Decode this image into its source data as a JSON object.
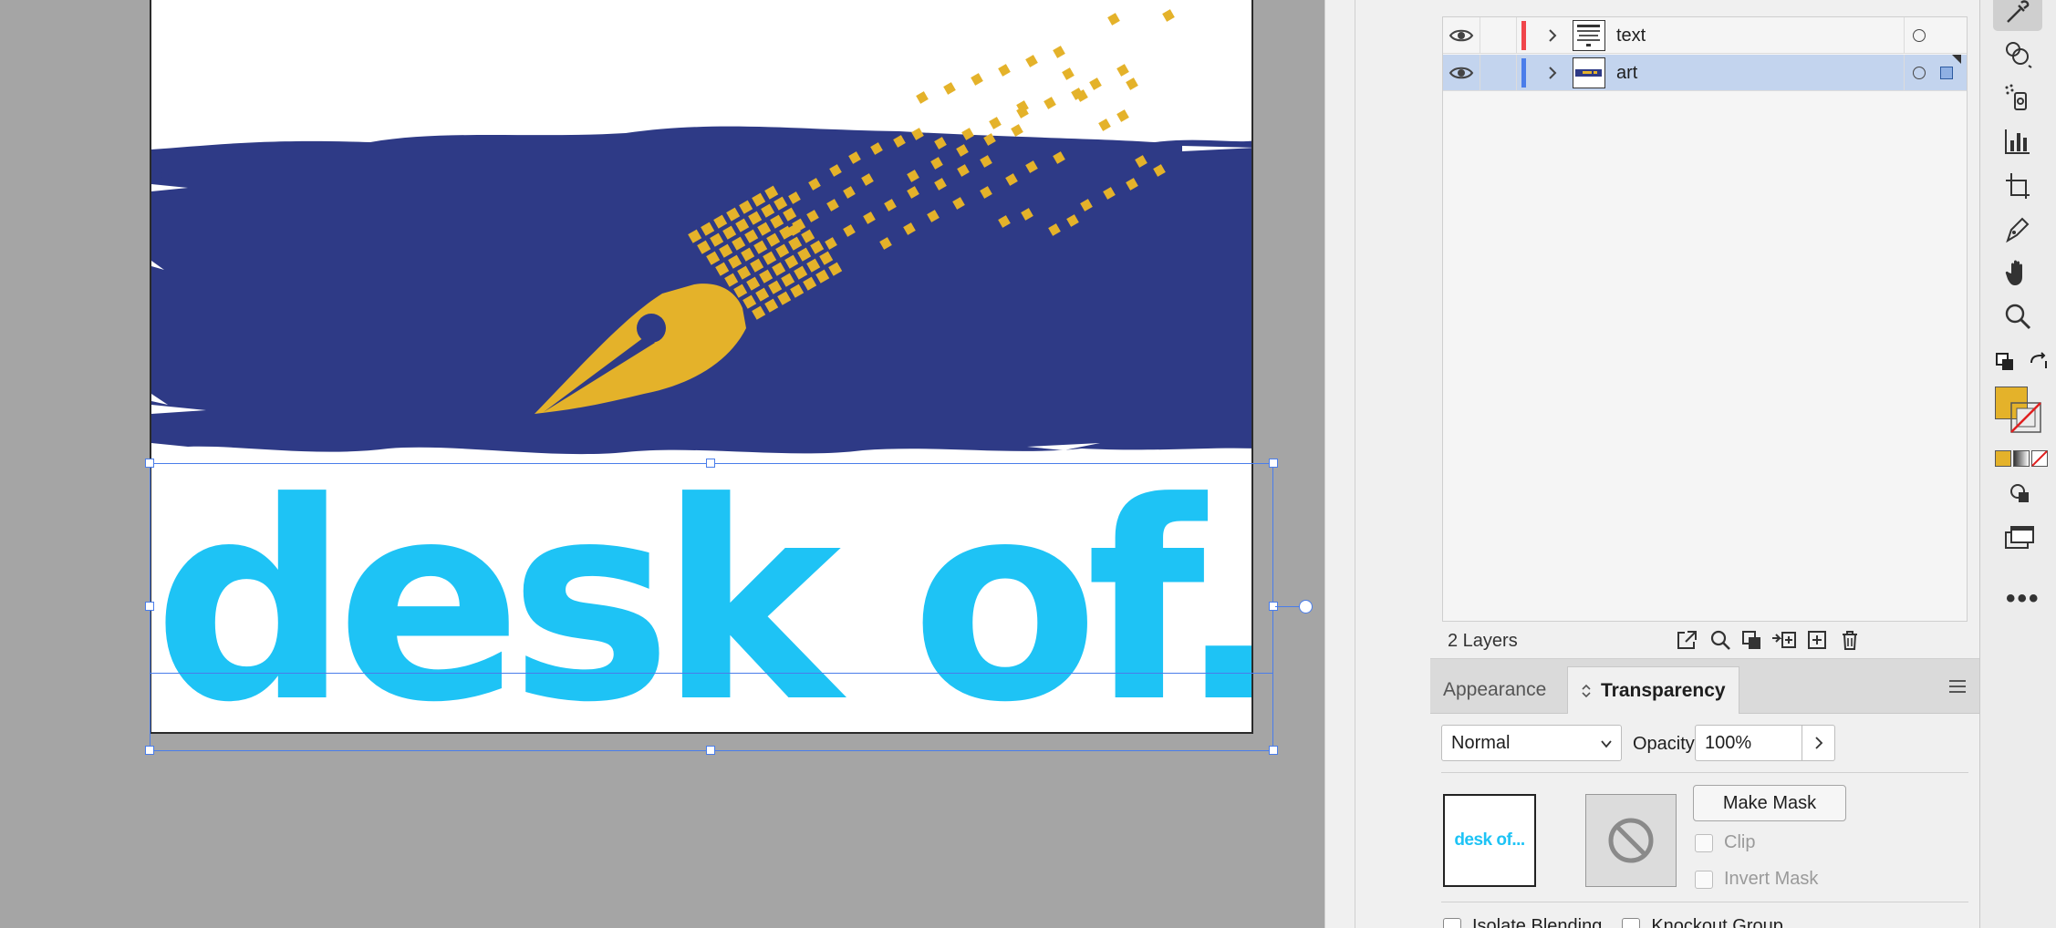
{
  "artboard": {
    "headline_text": "desk of...",
    "colors": {
      "blue_band": "#2e3a86",
      "gold": "#e4b22a",
      "cyan": "#1ec3f5"
    }
  },
  "layers_panel": {
    "layers": [
      {
        "name": "text",
        "color": "#f0454b",
        "selected": false
      },
      {
        "name": "art",
        "color": "#4a7dea",
        "selected": true
      }
    ],
    "layer_count": "2 Layers"
  },
  "transparency_panel": {
    "tabs": [
      {
        "label": "Appearance",
        "active": false
      },
      {
        "label": "Transparency",
        "active": true
      }
    ],
    "blend_mode": "Normal",
    "opacity_label": "Opacity:",
    "opacity_value": "100%",
    "object_thumb_text": "desk of...",
    "make_mask_label": "Make Mask",
    "clip_label": "Clip",
    "invert_mask_label": "Invert Mask",
    "isolate_blending_label": "Isolate Blending",
    "knockout_group_label": "Knockout Group"
  },
  "toolbar": {
    "tools": [
      "eyedropper-icon",
      "shape-builder-icon",
      "symbol-sprayer-icon",
      "graph-icon",
      "artboard-icon",
      "pen-icon",
      "hand-icon",
      "zoom-icon"
    ],
    "fill_color": "#e4b22a",
    "stroke": "none"
  }
}
